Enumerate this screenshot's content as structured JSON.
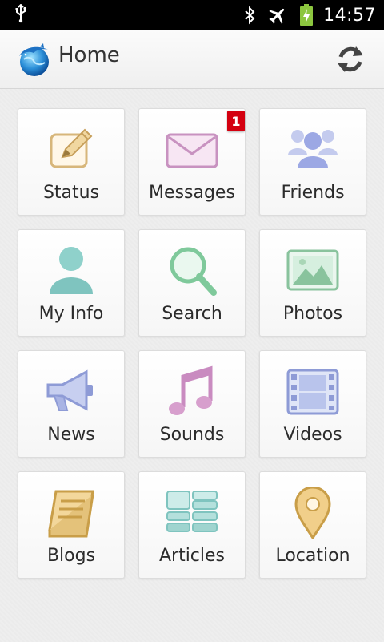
{
  "status_bar": {
    "time": "14:57",
    "icons": [
      "usb-icon",
      "bluetooth-icon",
      "airplane-mode-icon",
      "battery-charging-icon"
    ]
  },
  "action_bar": {
    "title": "Home",
    "logo_icon": "dolphin-globe-logo",
    "refresh_icon": "refresh-icon"
  },
  "grid": {
    "tiles": [
      {
        "label": "Status",
        "icon": "status-edit-icon"
      },
      {
        "label": "Messages",
        "icon": "envelope-icon",
        "badge": "1"
      },
      {
        "label": "Friends",
        "icon": "friends-icon"
      },
      {
        "label": "My Info",
        "icon": "user-icon"
      },
      {
        "label": "Search",
        "icon": "magnifier-icon"
      },
      {
        "label": "Photos",
        "icon": "photo-icon"
      },
      {
        "label": "News",
        "icon": "megaphone-icon"
      },
      {
        "label": "Sounds",
        "icon": "music-note-icon"
      },
      {
        "label": "Videos",
        "icon": "film-icon"
      },
      {
        "label": "Blogs",
        "icon": "book-icon"
      },
      {
        "label": "Articles",
        "icon": "articles-list-icon"
      },
      {
        "label": "Location",
        "icon": "map-pin-icon"
      }
    ]
  },
  "colors": {
    "status_bar_bg": "#000000",
    "battery_green": "#8cc63f",
    "badge_red": "#d40010"
  }
}
